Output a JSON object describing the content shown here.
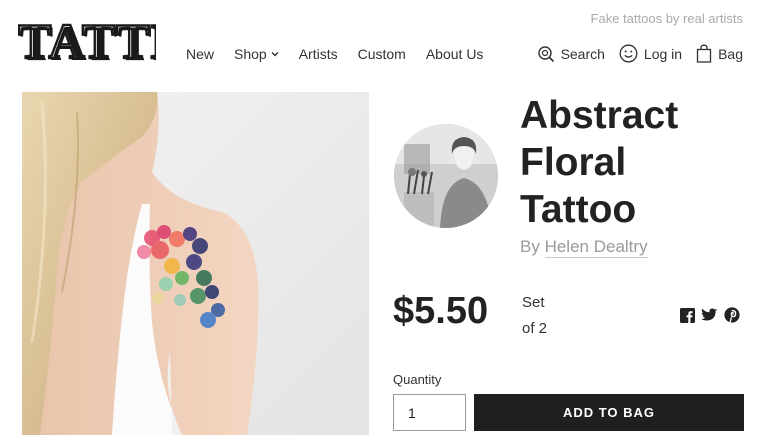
{
  "brand": {
    "logo_text": "TATTLY",
    "tagline": "Fake tattoos by real artists"
  },
  "nav": [
    {
      "label": "New"
    },
    {
      "label": "Shop"
    },
    {
      "label": "Artists"
    },
    {
      "label": "Custom"
    },
    {
      "label": "About Us"
    }
  ],
  "utilities": {
    "search": "Search",
    "login": "Log in",
    "bag": "Bag"
  },
  "icons": {
    "search": "search-icon",
    "login": "smiley-icon",
    "bag": "bag-icon",
    "facebook": "facebook-icon",
    "twitter": "twitter-icon",
    "pinterest": "pinterest-icon"
  },
  "product": {
    "title_line1": "Abstract",
    "title_line2": "Floral",
    "title_line3": "Tattoo",
    "by_prefix": "By",
    "artist": "Helen Dealtry",
    "price": "$5.50",
    "set_line1": "Set",
    "set_line2": "of 2",
    "quantity_label": "Quantity",
    "quantity_value": "1",
    "add_to_bag": "ADD TO BAG"
  },
  "colors": {
    "button_bg": "#1f1f1f",
    "muted_text": "#9a9a9a",
    "text": "#222222"
  }
}
